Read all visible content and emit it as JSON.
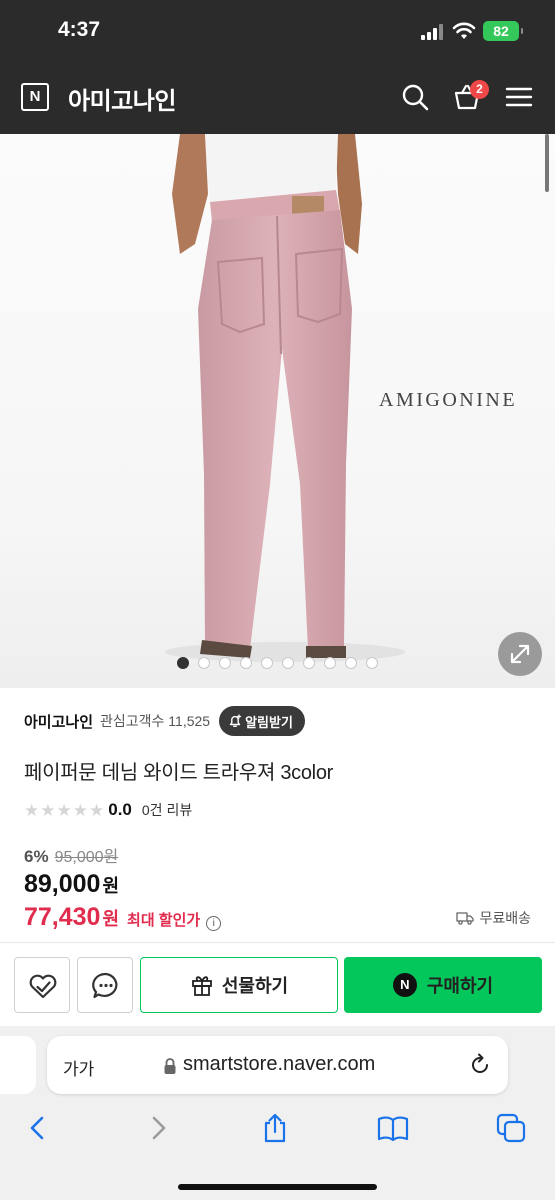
{
  "status_bar": {
    "time": "4:37",
    "battery": "82"
  },
  "header": {
    "logo_letter": "N",
    "store_name": "아미고나인",
    "cart_count": "2"
  },
  "product_image": {
    "watermark": "AMIGONINE",
    "carousel_total": 10,
    "carousel_active": 1
  },
  "seller": {
    "name": "아미고나인",
    "followers": "관심고객수 11,525",
    "alarm_button": "알림받기"
  },
  "product": {
    "title": "페이퍼문 데님 와이드 트라우져 3color",
    "rating": "0.0",
    "reviews": "0건 리뷰",
    "discount_rate": "6%",
    "original_price": "95,000원",
    "price": "89,000",
    "price_unit": "원",
    "max_discount_price": "77,430",
    "max_discount_unit": "원",
    "max_discount_label": "최대 할인가",
    "info_icon": "i",
    "shipping": "무료배송"
  },
  "actions": {
    "gift_label": "선물하기",
    "npay_letter": "N",
    "buy_label": "구매하기"
  },
  "browser": {
    "aa_label": "가가",
    "url": "smartstore.naver.com"
  },
  "colors": {
    "naver_green": "#03c75a",
    "discount_red": "#e22c4e",
    "header_bg": "#2b2b2b",
    "badge_red": "#f04848"
  }
}
